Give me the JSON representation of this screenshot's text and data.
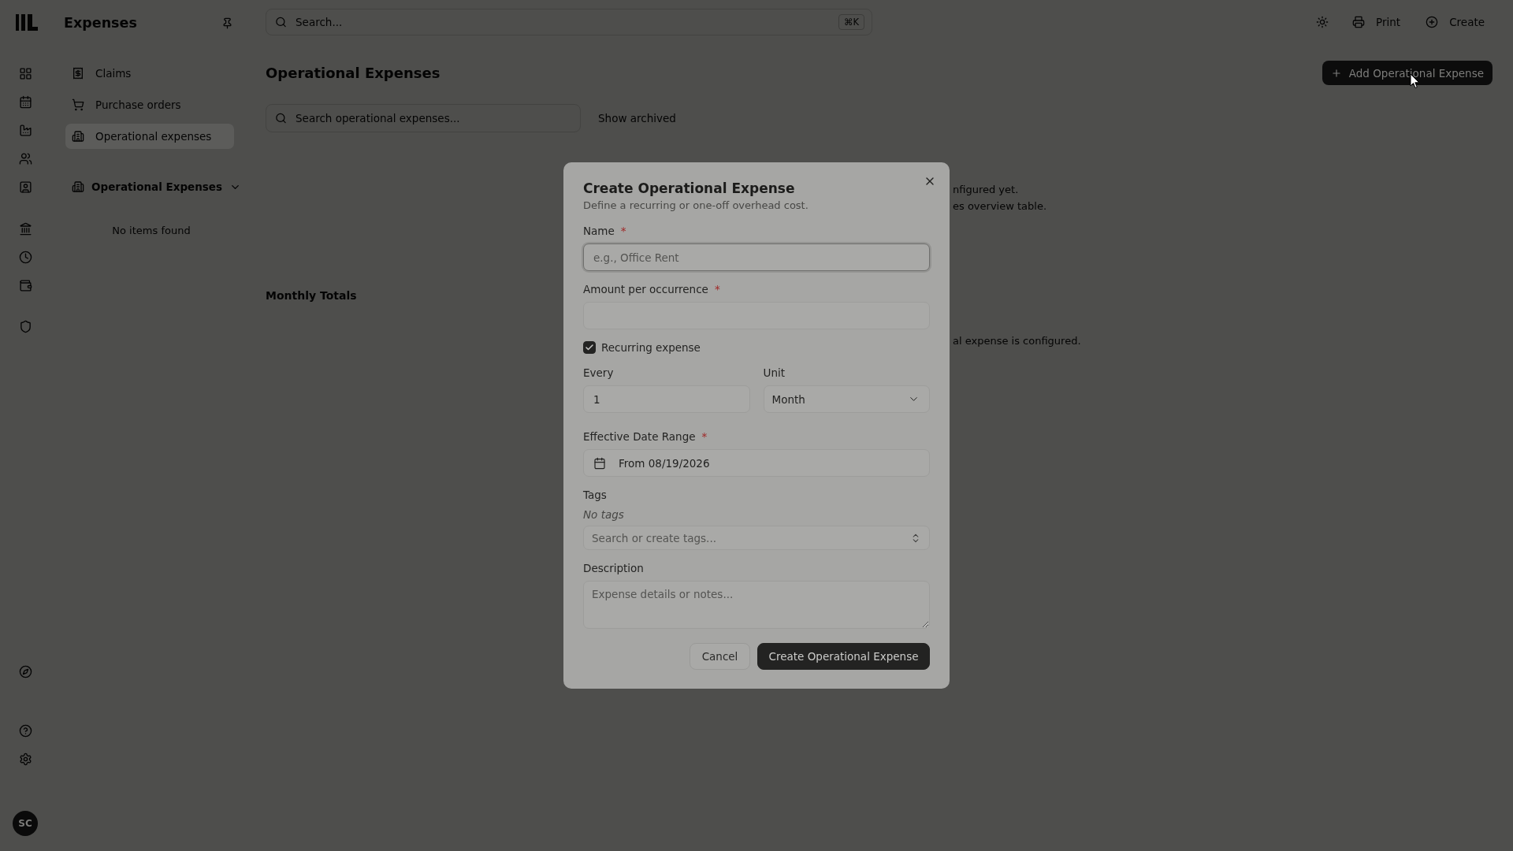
{
  "sidebar": {
    "title": "Expenses",
    "items": [
      {
        "label": "Claims",
        "selected": false
      },
      {
        "label": "Purchase orders",
        "selected": false
      },
      {
        "label": "Operational expenses",
        "selected": true
      }
    ],
    "section": {
      "title": "Operational Expenses",
      "expanded": true,
      "empty_text": "No items found"
    }
  },
  "user": {
    "initials": "SC"
  },
  "topbar": {
    "search": {
      "placeholder": "Search...",
      "shortcut": "⌘K"
    },
    "actions": [
      {
        "label": "Print"
      },
      {
        "label": "Create"
      }
    ]
  },
  "page": {
    "title": "Operational Expenses",
    "add_button": "Add Operational Expense",
    "search": {
      "placeholder": "Search operational expenses..."
    },
    "show_archived": "Show archived",
    "empty_state": {
      "title": "nfigured yet.",
      "description": "es overview table."
    },
    "monthly_totals": {
      "title": "Monthly Totals",
      "empty_text": "al expense is configured."
    }
  },
  "dialog": {
    "title": "Create Operational Expense",
    "description": "Define a recurring or one-off overhead cost.",
    "name": {
      "label": "Name",
      "required_mark": "*",
      "placeholder": "e.g., Office Rent",
      "focused": true
    },
    "amount": {
      "label": "Amount per occurrence",
      "required_mark": "*",
      "focused": false
    },
    "recurring": {
      "label": "Recurring expense",
      "checked": true
    },
    "every": {
      "label": "Every",
      "value": "1"
    },
    "unit": {
      "label": "Unit",
      "value": "Month"
    },
    "date_range": {
      "label": "Effective Date Range",
      "required_mark": "*",
      "value": "From 08/19/2026"
    },
    "tags": {
      "label": "Tags",
      "empty_text": "No tags",
      "placeholder": "Search or create tags..."
    },
    "notes": {
      "label": "Description",
      "placeholder": "Expense details or notes..."
    },
    "buttons": [
      {
        "label": "Cancel",
        "kind": "secondary"
      },
      {
        "label": "Create Operational Expense",
        "kind": "primary"
      }
    ]
  }
}
